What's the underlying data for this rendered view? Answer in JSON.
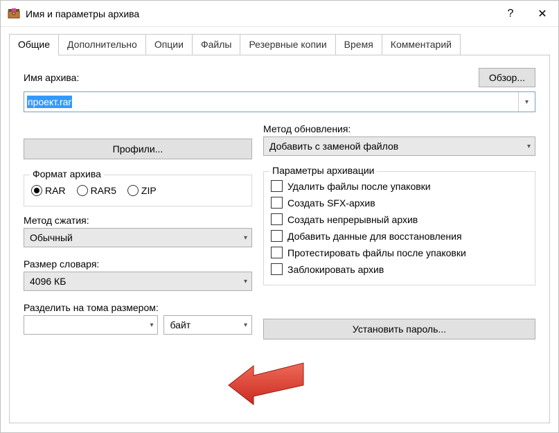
{
  "window": {
    "title": "Имя и параметры архива",
    "help_icon": "?",
    "close_icon": "✕"
  },
  "tabs": [
    "Общие",
    "Дополнительно",
    "Опции",
    "Файлы",
    "Резервные копии",
    "Время",
    "Комментарий"
  ],
  "archive_name": {
    "label": "Имя архива:",
    "browse_btn": "Обзор...",
    "value": "проект.rar"
  },
  "update_method": {
    "label": "Метод обновления:",
    "value": "Добавить с заменой файлов"
  },
  "profiles_btn": "Профили...",
  "format_group": {
    "legend": "Формат архива",
    "options": [
      "RAR",
      "RAR5",
      "ZIP"
    ],
    "selected": "RAR"
  },
  "compression": {
    "label": "Метод сжатия:",
    "value": "Обычный"
  },
  "dictionary": {
    "label": "Размер словаря:",
    "value": "4096 КБ"
  },
  "split": {
    "label": "Разделить на тома размером:",
    "size_value": "",
    "unit_value": "байт"
  },
  "params_group": {
    "legend": "Параметры архивации",
    "items": [
      "Удалить файлы после упаковки",
      "Создать SFX-архив",
      "Создать непрерывный архив",
      "Добавить данные для восстановления",
      "Протестировать файлы после упаковки",
      "Заблокировать архив"
    ]
  },
  "set_password_btn": "Установить пароль...",
  "colors": {
    "arrow": "#e53a2e"
  }
}
